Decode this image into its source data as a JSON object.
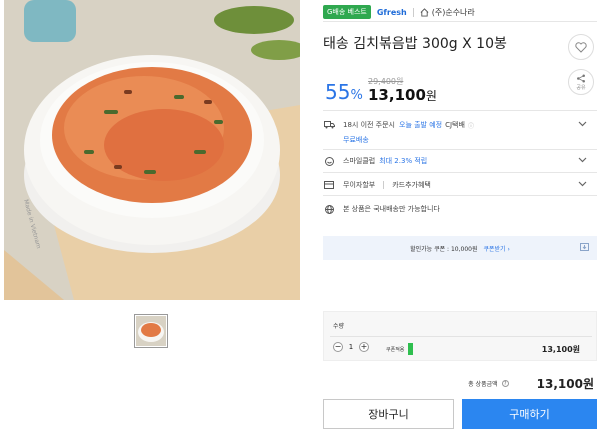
{
  "topbar": {
    "badge": "G배송 베스트",
    "brand": "Gfresh",
    "seller": "(주)순수나라"
  },
  "product": {
    "title": "태송 김치볶음밥 300g X 10봉",
    "discount_rate": "55",
    "discount_unit": "%",
    "original_price": "29,400원",
    "price": "13,100",
    "price_unit": "원"
  },
  "actions": {
    "share_label": "공유"
  },
  "delivery": {
    "text": "18시 이전 주문시",
    "highlight": "오늘 출발 예정",
    "carrier": "CJ택배",
    "free": "무료배송"
  },
  "smile": {
    "label": "스마일클럽",
    "highlight": "최대 2.3% 적립"
  },
  "benefits": {
    "installment": "무이자할부",
    "card": "카드추가혜택"
  },
  "domestic": {
    "text": "본 상품은 국내배송만 가능합니다"
  },
  "coupon": {
    "text": "할인가능 쿠폰 : 10,000원",
    "link": "쿠폰받기 ›"
  },
  "quantity": {
    "label": "수량",
    "value": "1",
    "coupon_tag": "쿠폰적용",
    "line_price": "13,100원"
  },
  "total": {
    "label": "총 상품금액",
    "price": "13,100원"
  },
  "buttons": {
    "cart": "장바구니",
    "buy": "구매하기"
  },
  "colors": {
    "accent": "#2b75e6",
    "buy": "#2b86f0",
    "badge": "#2fa84f"
  }
}
